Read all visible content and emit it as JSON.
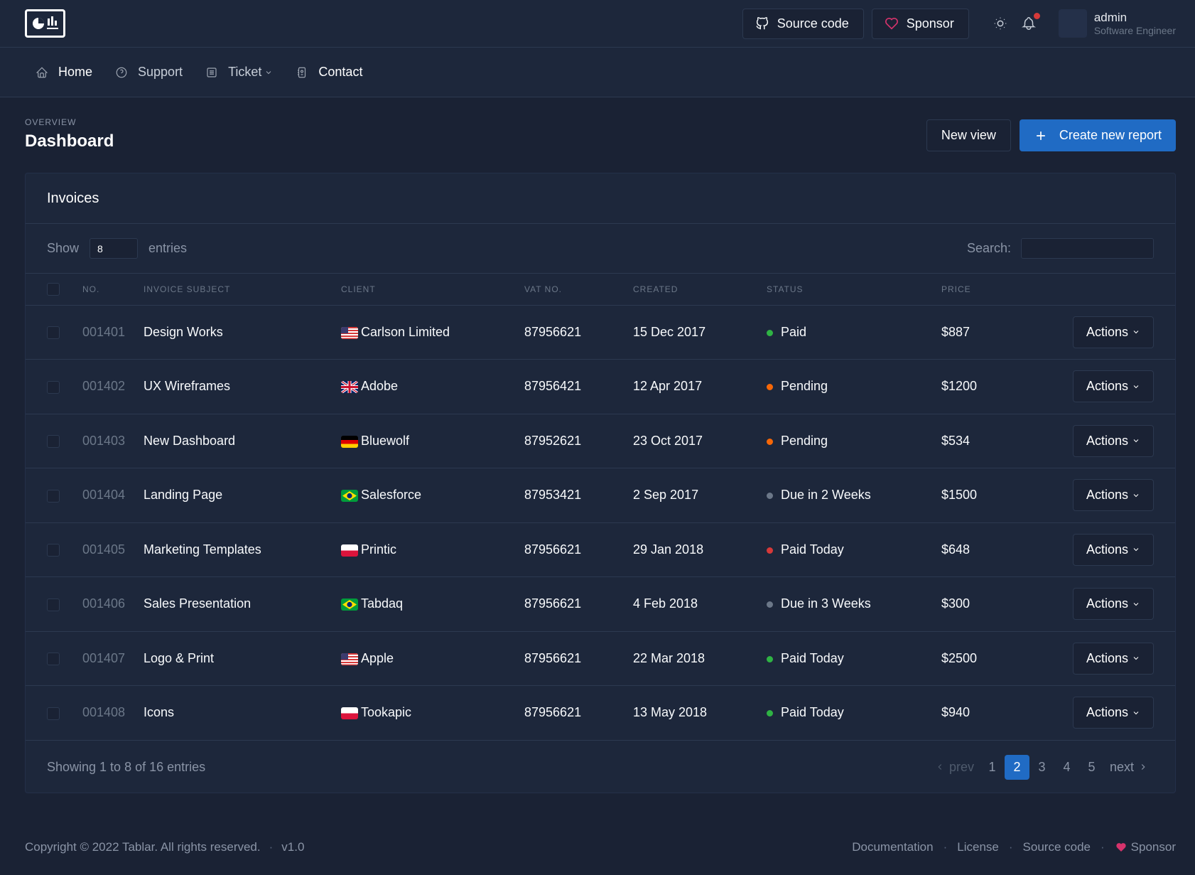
{
  "header": {
    "source_code_label": "Source code",
    "sponsor_label": "Sponsor",
    "user_name": "admin",
    "user_role": "Software Engineer"
  },
  "nav": {
    "items": [
      {
        "label": "Home",
        "icon": "home-icon"
      },
      {
        "label": "Support",
        "icon": "help-circle-icon"
      },
      {
        "label": "Ticket",
        "icon": "list-icon"
      },
      {
        "label": "Contact",
        "icon": "address-book-icon"
      }
    ]
  },
  "page": {
    "pretitle": "Overview",
    "title": "Dashboard",
    "new_view_label": "New view",
    "create_report_label": "Create new report"
  },
  "invoices": {
    "title": "Invoices",
    "show_label": "Show",
    "entries_value": "8",
    "entries_label": "entries",
    "search_label": "Search:",
    "columns": [
      "No.",
      "Invoice Subject",
      "Client",
      "VAT No.",
      "Created",
      "Status",
      "Price"
    ],
    "actions_label": "Actions",
    "rows": [
      {
        "no": "001401",
        "subject": "Design Works",
        "client": "Carlson Limited",
        "flag": "us",
        "vat": "87956621",
        "created": "15 Dec 2017",
        "status": "Paid",
        "status_color": "#2fb344",
        "price": "$887"
      },
      {
        "no": "001402",
        "subject": "UX Wireframes",
        "client": "Adobe",
        "flag": "gb",
        "vat": "87956421",
        "created": "12 Apr 2017",
        "status": "Pending",
        "status_color": "#f76707",
        "price": "$1200"
      },
      {
        "no": "001403",
        "subject": "New Dashboard",
        "client": "Bluewolf",
        "flag": "de",
        "vat": "87952621",
        "created": "23 Oct 2017",
        "status": "Pending",
        "status_color": "#f76707",
        "price": "$534"
      },
      {
        "no": "001404",
        "subject": "Landing Page",
        "client": "Salesforce",
        "flag": "br",
        "vat": "87953421",
        "created": "2 Sep 2017",
        "status": "Due in 2 Weeks",
        "status_color": "#6b7788",
        "price": "$1500"
      },
      {
        "no": "001405",
        "subject": "Marketing Templates",
        "client": "Printic",
        "flag": "pl",
        "vat": "87956621",
        "created": "29 Jan 2018",
        "status": "Paid Today",
        "status_color": "#d63939",
        "price": "$648"
      },
      {
        "no": "001406",
        "subject": "Sales Presentation",
        "client": "Tabdaq",
        "flag": "br",
        "vat": "87956621",
        "created": "4 Feb 2018",
        "status": "Due in 3 Weeks",
        "status_color": "#6b7788",
        "price": "$300"
      },
      {
        "no": "001407",
        "subject": "Logo & Print",
        "client": "Apple",
        "flag": "us",
        "vat": "87956621",
        "created": "22 Mar 2018",
        "status": "Paid Today",
        "status_color": "#2fb344",
        "price": "$2500"
      },
      {
        "no": "001408",
        "subject": "Icons",
        "client": "Tookapic",
        "flag": "pl",
        "vat": "87956621",
        "created": "13 May 2018",
        "status": "Paid Today",
        "status_color": "#2fb344",
        "price": "$940"
      }
    ],
    "showing_text": "Showing 1 to 8 of 16 entries",
    "pagination": {
      "prev_label": "prev",
      "next_label": "next",
      "pages": [
        "1",
        "2",
        "3",
        "4",
        "5"
      ],
      "active": "2"
    }
  },
  "footer": {
    "copyright": "Copyright © 2022 Tablar. All rights reserved.",
    "version": "v1.0",
    "links": [
      "Documentation",
      "License",
      "Source code"
    ],
    "sponsor": "Sponsor"
  }
}
